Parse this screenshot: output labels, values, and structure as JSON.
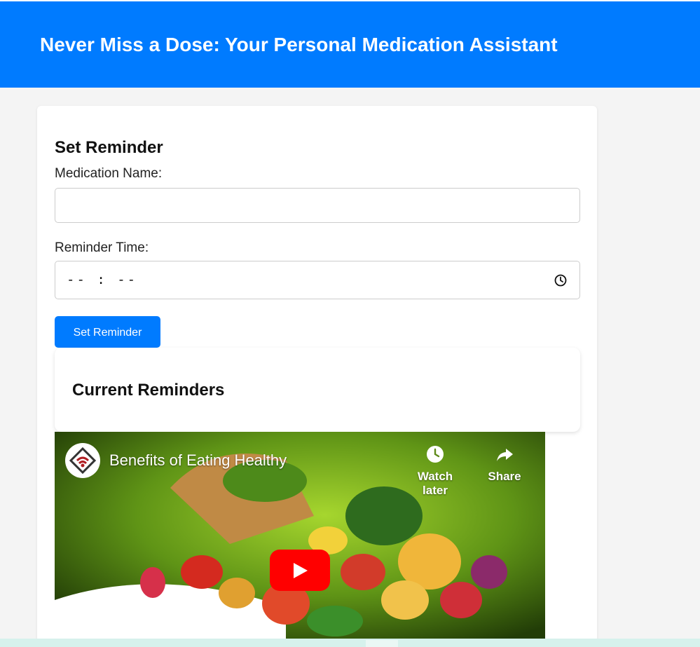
{
  "header": {
    "title": "Never Miss a Dose: Your Personal Medication Assistant"
  },
  "form": {
    "heading": "Set Reminder",
    "medication_label": "Medication Name:",
    "medication_value": "",
    "time_label": "Reminder Time:",
    "time_value": "-- : --",
    "submit_label": "Set Reminder"
  },
  "reminders": {
    "heading": "Current Reminders"
  },
  "video": {
    "title": "Benefits of Eating Healthy",
    "watch_later_label": "Watch later",
    "share_label": "Share",
    "icons": [
      "channel-logo",
      "clock-icon",
      "share-arrow-icon",
      "play-icon"
    ]
  },
  "colors": {
    "primary": "#007bff",
    "background": "#f4f4f4",
    "play": "#ff0000"
  }
}
